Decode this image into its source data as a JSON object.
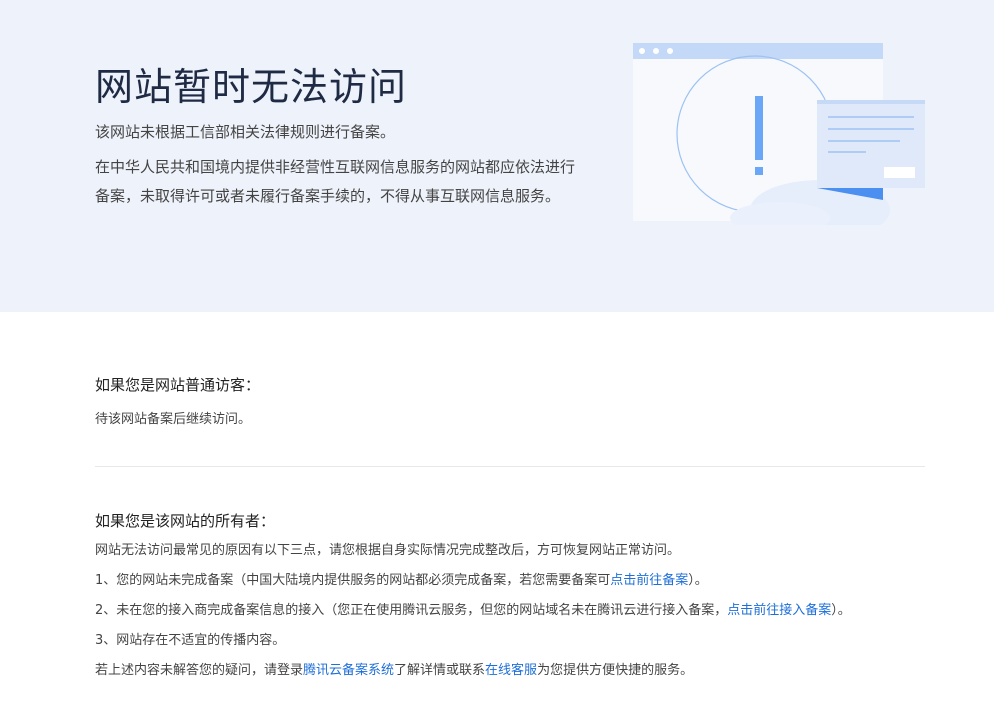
{
  "hero": {
    "title": "网站暂时无法访问",
    "subtitle": "该网站未根据工信部相关法律规则进行备案。",
    "description": "在中华人民共和国境内提供非经营性互联网信息服务的网站都应依法进行备案，未取得许可或者未履行备案手续的，不得从事互联网信息服务。"
  },
  "visitor": {
    "title": "如果您是网站普通访客：",
    "text": "待该网站备案后继续访问。"
  },
  "owner": {
    "title": "如果您是该网站的所有者：",
    "intro": "网站无法访问最常见的原因有以下三点，请您根据自身实际情况完成整改后，方可恢复网站正常访问。",
    "item1_text": "1、您的网站未完成备案（中国大陆境内提供服务的网站都必须完成备案，若您需要备案可",
    "item1_link": "点击前往备案",
    "item1_end": "）。",
    "item2_text": "2、未在您的接入商完成备案信息的接入（您正在使用腾讯云服务，但您的网站域名未在腾讯云进行接入备案，",
    "item2_link": "点击前往接入备案",
    "item2_end": "）。",
    "item3_text": "3、网站存在不适宜的传播内容。",
    "footer_prefix": "若上述内容未解答您的疑问，请登录",
    "footer_link1": "腾讯云备案系统",
    "footer_middle": "了解详情或联系",
    "footer_link2": "在线客服",
    "footer_suffix": "为您提供方便快捷的服务。"
  },
  "colors": {
    "hero_bg": "#eef2fa",
    "link": "#1e6fd9",
    "accent": "#6aa8f7"
  }
}
